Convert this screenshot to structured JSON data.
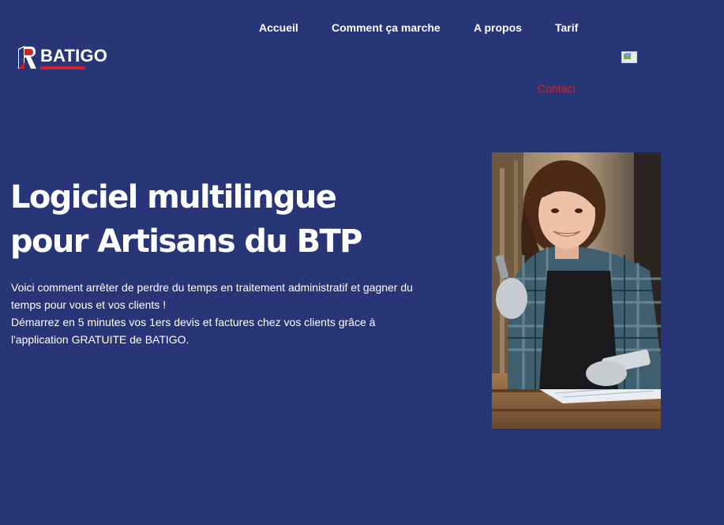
{
  "brand": {
    "name": "BATIGO",
    "accent_color": "#d2222a",
    "background_color": "#283677"
  },
  "nav": {
    "items": [
      {
        "label": "Accueil"
      },
      {
        "label": "Comment ça marche"
      },
      {
        "label": "A propos"
      },
      {
        "label": "Tarif"
      }
    ],
    "contact_label": "Contact",
    "language_icon": "flag-icon"
  },
  "hero": {
    "title_line1": "Logiciel multilingue",
    "title_line2": "pour Artisans du BTP",
    "paragraph_lines": [
      "Voici comment arrêter de perdre du temps en traitement administratif et gagner du temps pour vous et vos clients !",
      "Démarrez en 5 minutes vos 1ers devis et factures chez vos clients grâce à l'application GRATUITE de BATIGO."
    ],
    "photo_icon": "artisan-photo"
  }
}
